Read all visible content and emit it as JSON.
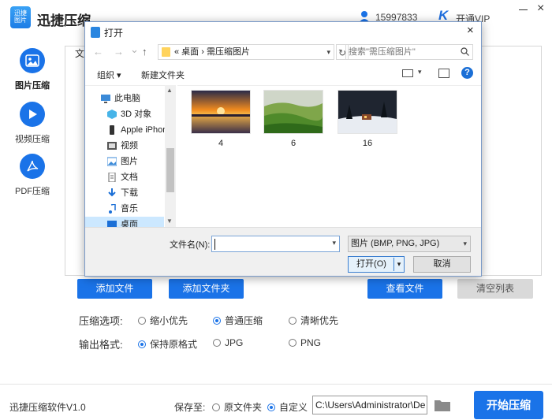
{
  "app": {
    "logo_text": "迅捷 图片",
    "title": "迅捷压缩",
    "user_phone": "15997833",
    "vip_badge": "K",
    "vip_label": "开通VIP",
    "win_close": "×"
  },
  "sidebar": {
    "items": [
      {
        "label": "图片压缩",
        "icon": "image-icon"
      },
      {
        "label": "视频压缩",
        "icon": "play-icon"
      },
      {
        "label": "PDF压缩",
        "icon": "pdf-icon"
      }
    ]
  },
  "main": {
    "column_header": "文"
  },
  "buttons": {
    "add_file": "添加文件",
    "add_folder": "添加文件夹",
    "view_file": "查看文件",
    "clear_list": "清空列表"
  },
  "options": {
    "compress_label": "压缩选项:",
    "compress_choices": [
      "缩小优先",
      "普通压缩",
      "清晰优先"
    ],
    "compress_selected": "普通压缩",
    "format_label": "输出格式:",
    "format_choices": [
      "保持原格式",
      "JPG",
      "PNG"
    ],
    "format_selected": "保持原格式"
  },
  "footer": {
    "version": "迅捷压缩软件V1.0",
    "save_to_label": "保存至:",
    "save_choices": [
      "原文件夹",
      "自定义"
    ],
    "save_selected": "自定义",
    "path": "C:\\Users\\Administrator\\De",
    "start_button": "开始压缩"
  },
  "dialog": {
    "title": "打开",
    "close": "×",
    "nav": {
      "back": "←",
      "forward": "→",
      "recent": "⌄",
      "up": "↑"
    },
    "address": "« 桌面 › 需压缩图片",
    "address_drop": "▾",
    "refresh": "↻",
    "search_placeholder": "搜索\"需压缩图片\"",
    "toolbar": {
      "organize": "组织 ▾",
      "new_folder": "新建文件夹",
      "view_drop": "▾",
      "help": "?"
    },
    "nav_pane": [
      {
        "label": "此电脑",
        "icon": "computer-icon",
        "indent": false
      },
      {
        "label": "3D 对象",
        "icon": "cube-icon",
        "indent": true
      },
      {
        "label": "Apple iPhone",
        "icon": "phone-icon",
        "indent": true
      },
      {
        "label": "视频",
        "icon": "video-icon",
        "indent": true
      },
      {
        "label": "图片",
        "icon": "picture-icon",
        "indent": true
      },
      {
        "label": "文档",
        "icon": "document-icon",
        "indent": true
      },
      {
        "label": "下载",
        "icon": "download-icon",
        "indent": true
      },
      {
        "label": "音乐",
        "icon": "music-icon",
        "indent": true
      },
      {
        "label": "桌面",
        "icon": "desktop-icon",
        "indent": true,
        "selected": true
      }
    ],
    "files": [
      {
        "name": "4",
        "thumb": "sunset-lake"
      },
      {
        "name": "6",
        "thumb": "green-hills"
      },
      {
        "name": "16",
        "thumb": "snow-cabin"
      }
    ],
    "filename_label": "文件名(N):",
    "filename_value": "",
    "filetype": "图片 (BMP, PNG, JPG)",
    "open_button": "打开(O)",
    "open_drop": "▾",
    "cancel_button": "取消"
  }
}
